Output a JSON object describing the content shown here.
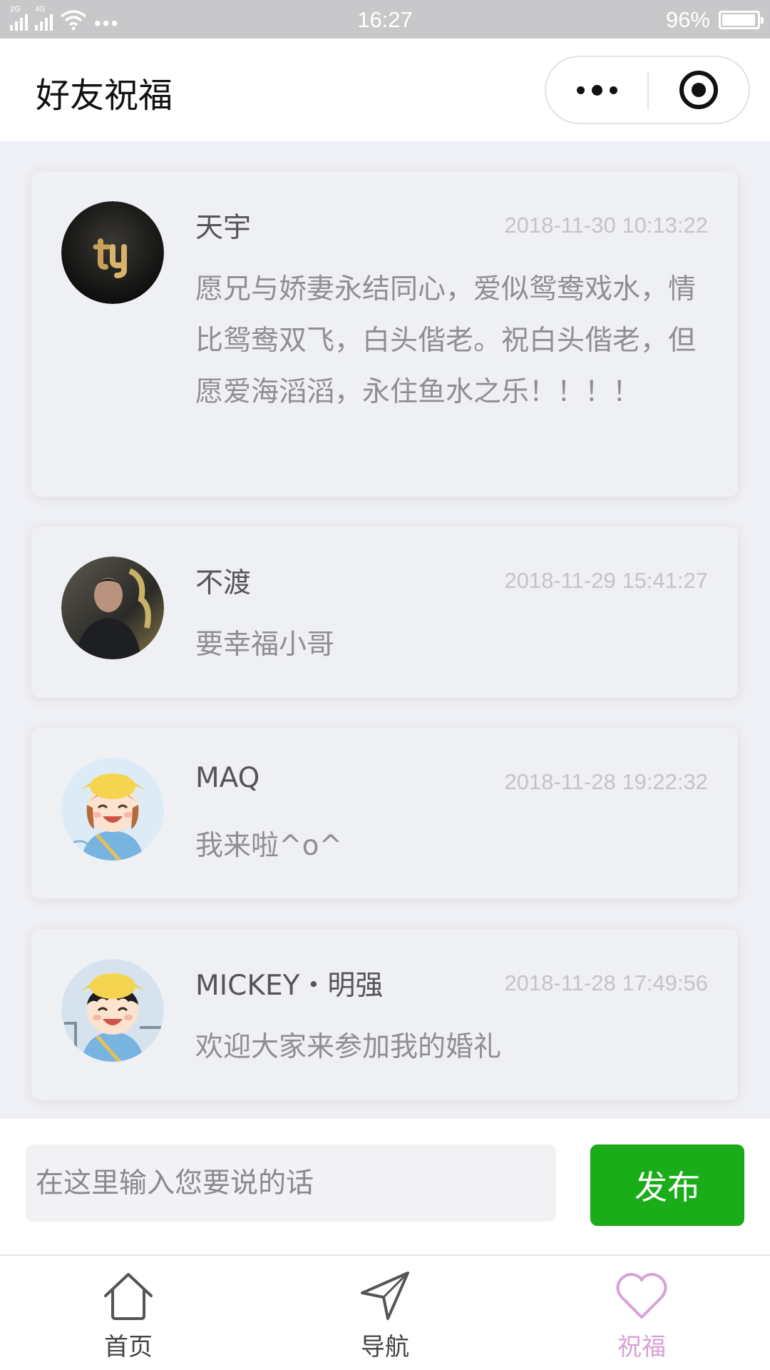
{
  "status_bar": {
    "network_1": "2G",
    "network_2": "4G",
    "time": "16:27",
    "battery": "96%",
    "battery_level": 0.96
  },
  "header": {
    "title": "好友祝福",
    "more_icon": "more-dots-icon",
    "close_icon": "target-circle-icon"
  },
  "messages": [
    {
      "name": "天宇",
      "time": "2018-11-30 10:13:22",
      "text": "愿兄与娇妻永结同心，爱似鸳鸯戏水，情比鸳鸯双飞，白头偕老。祝白头偕老，但愿爱海滔滔，永住鱼水之乐！！！！",
      "avatar": "ty-logo-avatar"
    },
    {
      "name": "不渡",
      "time": "2018-11-29 15:41:27",
      "text": "要幸福小哥",
      "avatar": "photo-avatar"
    },
    {
      "name": "MAQ",
      "time": "2018-11-28 19:22:32",
      "text": "我来啦^o^",
      "avatar": "cartoon-girl-avatar"
    },
    {
      "name": "MICKEY・明强",
      "time": "2018-11-28 17:49:56",
      "text": "欢迎大家来参加我的婚礼",
      "avatar": "cartoon-boy-avatar"
    }
  ],
  "composer": {
    "placeholder": "在这里输入您要说的话",
    "button": "发布"
  },
  "tabs": [
    {
      "label": "首页",
      "icon": "home-icon",
      "active": false
    },
    {
      "label": "导航",
      "icon": "navigation-arrow-icon",
      "active": false
    },
    {
      "label": "祝福",
      "icon": "heart-icon",
      "active": true
    }
  ],
  "colors": {
    "accent_green": "#1aad19",
    "active_tab": "#d9a2d6",
    "background": "#eef0f5"
  }
}
